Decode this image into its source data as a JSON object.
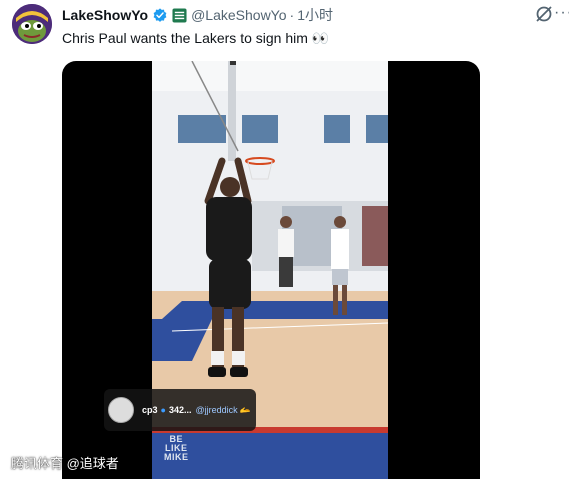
{
  "tweet": {
    "display_name": "LakeShowYo",
    "handle": "@LakeShowYo",
    "separator": "·",
    "time": "1小时",
    "text": "Chris Paul wants the Lakers to sign him 👀"
  },
  "icons": {
    "avatar": "frog-avatar",
    "verified": "verified-badge-icon",
    "affiliate": "affiliate-badge-icon",
    "grok": "grok-icon",
    "more": "more-icon"
  },
  "media": {
    "overlay": {
      "user": "cp3",
      "count": "342...",
      "mention": "@jjreddick",
      "emoji": "🫴"
    },
    "brand_lines": [
      "BE",
      "LIKE",
      "MIKE"
    ]
  },
  "watermark": "腾讯体育 @追球者",
  "colors": {
    "verified": "#1d9bf0",
    "secondary_text": "#536471",
    "court_blue": "#2f4f9e",
    "court_red": "#c83a2f"
  }
}
